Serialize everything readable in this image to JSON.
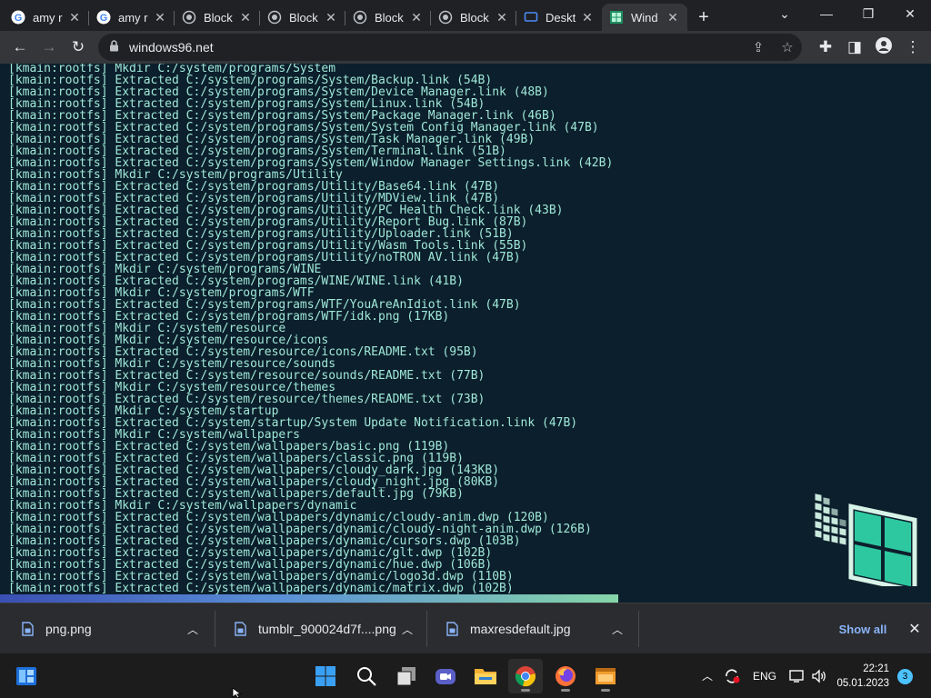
{
  "browser": {
    "tabs": [
      {
        "title": "amy r",
        "favicon": "google-g-icon"
      },
      {
        "title": "amy r",
        "favicon": "google-g-icon"
      },
      {
        "title": "Block",
        "favicon": "globe-icon"
      },
      {
        "title": "Block",
        "favicon": "globe-icon"
      },
      {
        "title": "Block",
        "favicon": "globe-icon"
      },
      {
        "title": "Block",
        "favicon": "globe-icon"
      },
      {
        "title": "Deskt",
        "favicon": "desktop-icon"
      },
      {
        "title": "Wind",
        "favicon": "windows96-icon",
        "active": true
      }
    ],
    "url": "windows96.net"
  },
  "terminal": {
    "lines": [
      "[kmain:rootfs] Mkdir C:/system/programs/System",
      "[kmain:rootfs] Extracted C:/system/programs/System/Backup.link (54B)",
      "[kmain:rootfs] Extracted C:/system/programs/System/Device Manager.link (48B)",
      "[kmain:rootfs] Extracted C:/system/programs/System/Linux.link (54B)",
      "[kmain:rootfs] Extracted C:/system/programs/System/Package Manager.link (46B)",
      "[kmain:rootfs] Extracted C:/system/programs/System/System Config Manager.link (47B)",
      "[kmain:rootfs] Extracted C:/system/programs/System/Task Manager.link (49B)",
      "[kmain:rootfs] Extracted C:/system/programs/System/Terminal.link (51B)",
      "[kmain:rootfs] Extracted C:/system/programs/System/Window Manager Settings.link (42B)",
      "[kmain:rootfs] Mkdir C:/system/programs/Utility",
      "[kmain:rootfs] Extracted C:/system/programs/Utility/Base64.link (47B)",
      "[kmain:rootfs] Extracted C:/system/programs/Utility/MDView.link (47B)",
      "[kmain:rootfs] Extracted C:/system/programs/Utility/PC Health Check.link (43B)",
      "[kmain:rootfs] Extracted C:/system/programs/Utility/Report Bug.link (87B)",
      "[kmain:rootfs] Extracted C:/system/programs/Utility/Uploader.link (51B)",
      "[kmain:rootfs] Extracted C:/system/programs/Utility/Wasm Tools.link (55B)",
      "[kmain:rootfs] Extracted C:/system/programs/Utility/noTRON AV.link (47B)",
      "[kmain:rootfs] Mkdir C:/system/programs/WINE",
      "[kmain:rootfs] Extracted C:/system/programs/WINE/WINE.link (41B)",
      "[kmain:rootfs] Mkdir C:/system/programs/WTF",
      "[kmain:rootfs] Extracted C:/system/programs/WTF/YouAreAnIdiot.link (47B)",
      "[kmain:rootfs] Extracted C:/system/programs/WTF/idk.png (17KB)",
      "[kmain:rootfs] Mkdir C:/system/resource",
      "[kmain:rootfs] Mkdir C:/system/resource/icons",
      "[kmain:rootfs] Extracted C:/system/resource/icons/README.txt (95B)",
      "[kmain:rootfs] Mkdir C:/system/resource/sounds",
      "[kmain:rootfs] Extracted C:/system/resource/sounds/README.txt (77B)",
      "[kmain:rootfs] Mkdir C:/system/resource/themes",
      "[kmain:rootfs] Extracted C:/system/resource/themes/README.txt (73B)",
      "[kmain:rootfs] Mkdir C:/system/startup",
      "[kmain:rootfs] Extracted C:/system/startup/System Update Notification.link (47B)",
      "[kmain:rootfs] Mkdir C:/system/wallpapers",
      "[kmain:rootfs] Extracted C:/system/wallpapers/basic.png (119B)",
      "[kmain:rootfs] Extracted C:/system/wallpapers/classic.png (119B)",
      "[kmain:rootfs] Extracted C:/system/wallpapers/cloudy_dark.jpg (143KB)",
      "[kmain:rootfs] Extracted C:/system/wallpapers/cloudy_night.jpg (80KB)",
      "[kmain:rootfs] Extracted C:/system/wallpapers/default.jpg (79KB)",
      "[kmain:rootfs] Mkdir C:/system/wallpapers/dynamic",
      "[kmain:rootfs] Extracted C:/system/wallpapers/dynamic/cloudy-anim.dwp (120B)",
      "[kmain:rootfs] Extracted C:/system/wallpapers/dynamic/cloudy-night-anim.dwp (126B)",
      "[kmain:rootfs] Extracted C:/system/wallpapers/dynamic/cursors.dwp (103B)",
      "[kmain:rootfs] Extracted C:/system/wallpapers/dynamic/glt.dwp (102B)",
      "[kmain:rootfs] Extracted C:/system/wallpapers/dynamic/hue.dwp (106B)",
      "[kmain:rootfs] Extracted C:/system/wallpapers/dynamic/logo3d.dwp (110B)",
      "[kmain:rootfs] Extracted C:/system/wallpapers/dynamic/matrix.dwp (102B)"
    ],
    "progress_fraction": 0.664
  },
  "downloads": {
    "items": [
      {
        "name": "png.png"
      },
      {
        "name": "tumblr_900024d7f....png"
      },
      {
        "name": "maxresdefault.jpg"
      }
    ],
    "show_all": "Show all"
  },
  "taskbar": {
    "language": "ENG",
    "time": "22:21",
    "date": "05.01.2023",
    "notification_count": "3"
  },
  "colors": {
    "terminal_bg": "#0c1f2c",
    "terminal_text": "#9fe8d8",
    "link_blue": "#8ab4f8"
  }
}
